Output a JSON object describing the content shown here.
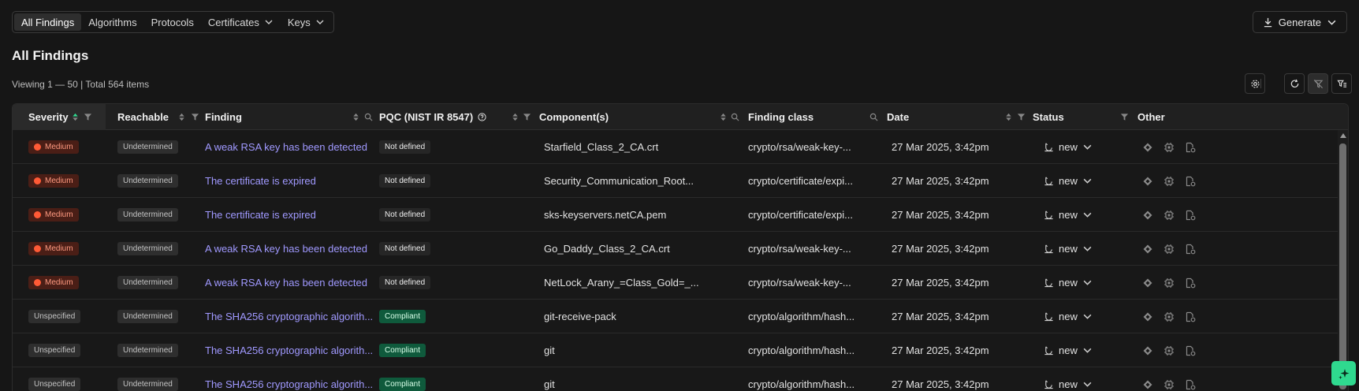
{
  "tabs": [
    {
      "label": "All Findings",
      "active": true,
      "dropdown": false
    },
    {
      "label": "Algorithms",
      "active": false,
      "dropdown": false
    },
    {
      "label": "Protocols",
      "active": false,
      "dropdown": false
    },
    {
      "label": "Certificates",
      "active": false,
      "dropdown": true
    },
    {
      "label": "Keys",
      "active": false,
      "dropdown": true
    }
  ],
  "generate": {
    "label": "Generate",
    "icon": "download-icon"
  },
  "page_title": "All Findings",
  "viewing_text": "Viewing 1 — 50 | Total 564 items",
  "toolbar": {
    "settings_icon": "gear-icon",
    "refresh_icon": "refresh-icon",
    "clear_filter_icon": "filter-off-icon",
    "filter_list_icon": "filter-list-icon"
  },
  "columns": {
    "severity": "Severity",
    "reachable": "Reachable",
    "finding": "Finding",
    "pqc": "PQC (NIST IR 8547)",
    "component": "Component(s)",
    "finding_class": "Finding class",
    "date": "Date",
    "status": "Status",
    "other": "Other"
  },
  "rows": [
    {
      "severity": "Medium",
      "severity_level": "medium",
      "reachable": "Undetermined",
      "finding": "A weak RSA key has been detected",
      "pqc": "Not defined",
      "pqc_level": "nd",
      "component": "Starfield_Class_2_CA.crt",
      "finding_class": "crypto/rsa/weak-key-...",
      "date": "27 Mar 2025, 3:42pm",
      "status": "new"
    },
    {
      "severity": "Medium",
      "severity_level": "medium",
      "reachable": "Undetermined",
      "finding": "The certificate is expired",
      "pqc": "Not defined",
      "pqc_level": "nd",
      "component": "Security_Communication_Root...",
      "finding_class": "crypto/certificate/expi...",
      "date": "27 Mar 2025, 3:42pm",
      "status": "new"
    },
    {
      "severity": "Medium",
      "severity_level": "medium",
      "reachable": "Undetermined",
      "finding": "The certificate is expired",
      "pqc": "Not defined",
      "pqc_level": "nd",
      "component": "sks-keyservers.netCA.pem",
      "finding_class": "crypto/certificate/expi...",
      "date": "27 Mar 2025, 3:42pm",
      "status": "new"
    },
    {
      "severity": "Medium",
      "severity_level": "medium",
      "reachable": "Undetermined",
      "finding": "A weak RSA key has been detected",
      "pqc": "Not defined",
      "pqc_level": "nd",
      "component": "Go_Daddy_Class_2_CA.crt",
      "finding_class": "crypto/rsa/weak-key-...",
      "date": "27 Mar 2025, 3:42pm",
      "status": "new"
    },
    {
      "severity": "Medium",
      "severity_level": "medium",
      "reachable": "Undetermined",
      "finding": "A weak RSA key has been detected",
      "pqc": "Not defined",
      "pqc_level": "nd",
      "component": "NetLock_Arany_=Class_Gold=_...",
      "finding_class": "crypto/rsa/weak-key-...",
      "date": "27 Mar 2025, 3:42pm",
      "status": "new"
    },
    {
      "severity": "Unspecified",
      "severity_level": "unspecified",
      "reachable": "Undetermined",
      "finding": "The SHA256 cryptographic algorith...",
      "pqc": "Compliant",
      "pqc_level": "compliant",
      "component": "git-receive-pack",
      "finding_class": "crypto/algorithm/hash...",
      "date": "27 Mar 2025, 3:42pm",
      "status": "new"
    },
    {
      "severity": "Unspecified",
      "severity_level": "unspecified",
      "reachable": "Undetermined",
      "finding": "The SHA256 cryptographic algorith...",
      "pqc": "Compliant",
      "pqc_level": "compliant",
      "component": "git",
      "finding_class": "crypto/algorithm/hash...",
      "date": "27 Mar 2025, 3:42pm",
      "status": "new"
    },
    {
      "severity": "Unspecified",
      "severity_level": "unspecified",
      "reachable": "Undetermined",
      "finding": "The SHA256 cryptographic algorith...",
      "pqc": "Compliant",
      "pqc_level": "compliant",
      "component": "git",
      "finding_class": "crypto/algorithm/hash...",
      "date": "27 Mar 2025, 3:42pm",
      "status": "new"
    }
  ],
  "other_icons": [
    "diamond-icon",
    "chip-icon",
    "file-settings-icon"
  ],
  "colors": {
    "background": "#161616",
    "accent_link": "#a099ff",
    "medium": "#ff5a36",
    "compliant": "#0f5a3c",
    "ai_button": "#2fd98f"
  }
}
